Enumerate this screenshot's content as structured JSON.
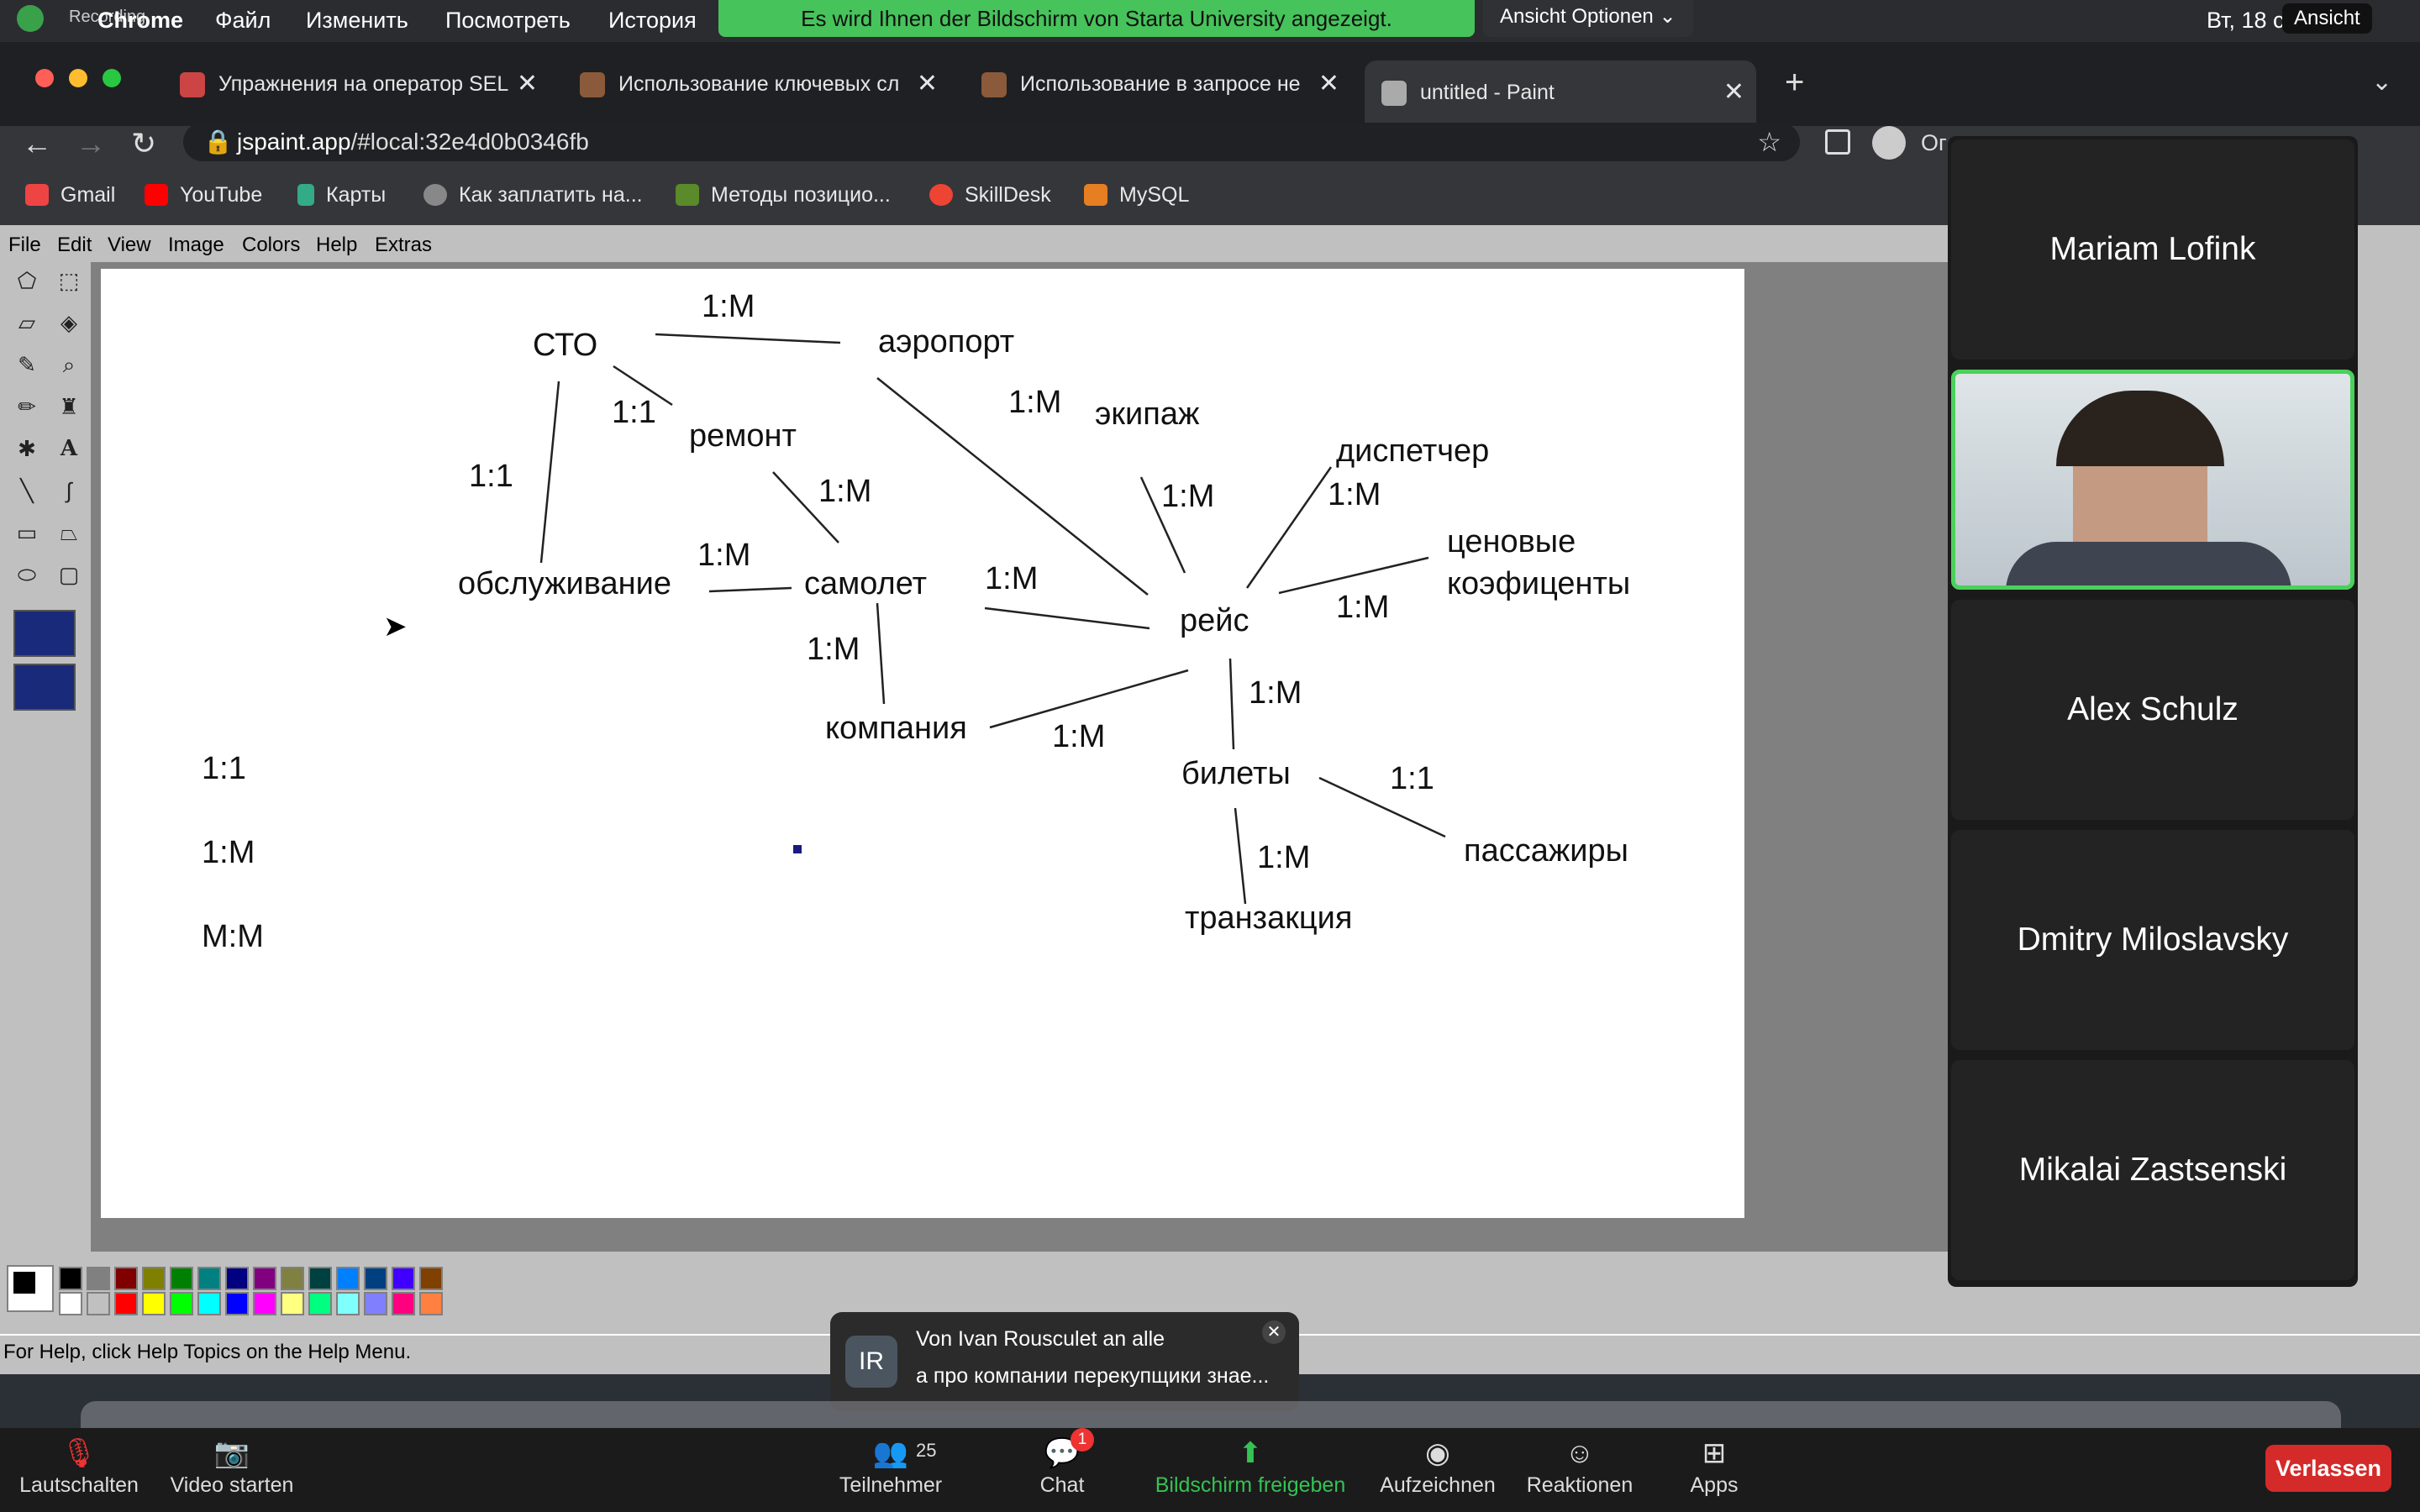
{
  "menubar": {
    "recording": "Recording",
    "app": "Chrome",
    "items": [
      "Файл",
      "Изменить",
      "Посмотреть",
      "История"
    ],
    "share_banner": "Es wird Ihnen der Bildschirm von Starta University angezeigt.",
    "view_options": "Ansicht Optionen",
    "clock": "Вт, 18 с",
    "ansicht": "Ansicht"
  },
  "tabs": [
    {
      "title": "Упражнения на оператор SEL",
      "active": false
    },
    {
      "title": "Использование ключевых сл",
      "active": false
    },
    {
      "title": "Использование в запросе не",
      "active": false
    },
    {
      "title": "untitled - Paint",
      "active": true
    }
  ],
  "address": {
    "host": "jspaint.app",
    "path": "/#local:32e4d0b0346fb",
    "profile": "Ог"
  },
  "bookmarks": [
    "Gmail",
    "YouTube",
    "Карты",
    "Как заплатить на...",
    "Методы позицио...",
    "SkillDesk",
    "MySQL"
  ],
  "paint": {
    "menu": [
      "File",
      "Edit",
      "View",
      "Image",
      "Colors",
      "Help",
      "Extras"
    ],
    "status": "For Help, click Help Topics on the Help Menu.",
    "diagram": {
      "nodes": [
        "СТО",
        "аэропорт",
        "ремонт",
        "экипаж",
        "диспетчер",
        "ценовые",
        "коэфиценты",
        "обслуживание",
        "самолет",
        "рейс",
        "компания",
        "билеты",
        "пассажиры",
        "транзакция"
      ],
      "relations": [
        "1:M",
        "1:1",
        "1:M",
        "1:1",
        "1:M",
        "1:M",
        "1:M",
        "1:M",
        "1:M",
        "1:M",
        "1:M",
        "1:M",
        "1:M",
        "1:1",
        "1:M"
      ],
      "legend": [
        "1:1",
        "1:M",
        "M:M"
      ]
    },
    "palette": [
      "#000000",
      "#808080",
      "#800000",
      "#808000",
      "#008000",
      "#008080",
      "#000080",
      "#800080",
      "#808040",
      "#004040",
      "#0080ff",
      "#004080",
      "#4000ff",
      "#804000",
      "#ffffff",
      "#c0c0c0",
      "#ff0000",
      "#ffff00",
      "#00ff00",
      "#00ffff",
      "#0000ff",
      "#ff00ff",
      "#ffff80",
      "#00ff80",
      "#80ffff",
      "#8080ff",
      "#ff0080",
      "#ff8040"
    ]
  },
  "participants": [
    "Mariam Lofink",
    "Alex Schulz",
    "Dmitry Miloslavsky",
    "Mikalai Zastsenski"
  ],
  "chat_toast": {
    "initials": "IR",
    "from": "Von Ivan Rousculet an alle",
    "message": "а про компании перекупщики знае..."
  },
  "zoom_bar": {
    "mute": "Lautschalten",
    "video": "Video starten",
    "participants": "Teilnehmer",
    "participant_count": "25",
    "chat": "Chat",
    "chat_badge": "1",
    "share": "Bildschirm freigeben",
    "record": "Aufzeichnen",
    "reactions": "Reaktionen",
    "apps": "Apps",
    "leave": "Verlassen"
  }
}
